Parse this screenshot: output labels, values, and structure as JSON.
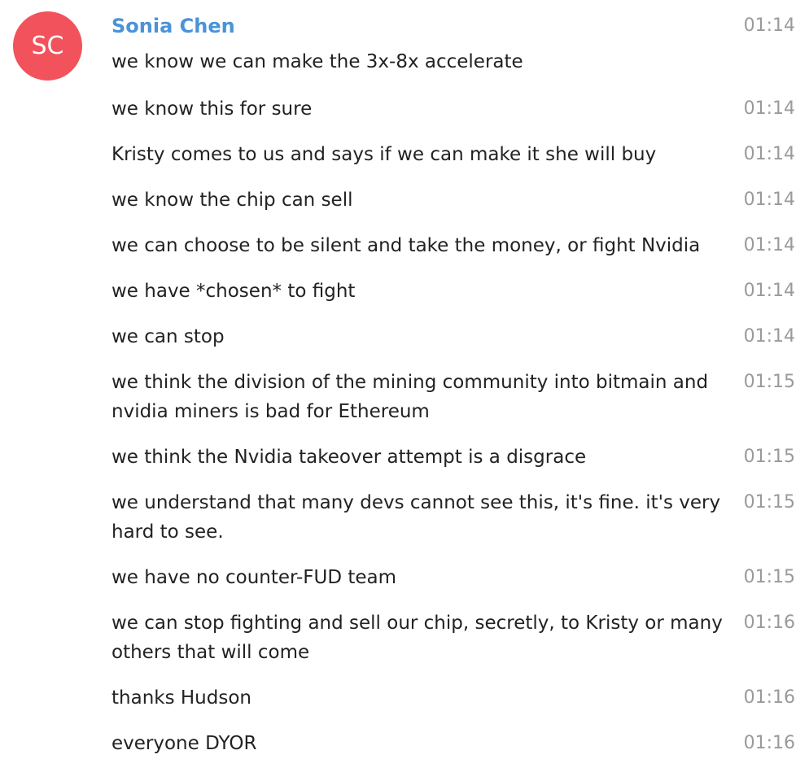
{
  "sender": {
    "initials": "SC",
    "name": "Sonia Chen",
    "avatar_color": "#f2525b",
    "name_color": "#4a93d8",
    "time": "01:14"
  },
  "messages": [
    {
      "text": "we know we can make the 3x-8x accelerate",
      "time": ""
    },
    {
      "text": "we know this for sure",
      "time": "01:14"
    },
    {
      "text": "Kristy comes to us and says if we can make it she will buy",
      "time": "01:14"
    },
    {
      "text": "we know the chip can sell",
      "time": "01:14"
    },
    {
      "text": "we can choose to be silent and take the money, or fight Nvidia",
      "time": "01:14"
    },
    {
      "text": "we have *chosen* to fight",
      "time": "01:14"
    },
    {
      "text": "we can stop",
      "time": "01:14"
    },
    {
      "text": "we think the division of the mining community into bitmain and nvidia miners is bad for Ethereum",
      "time": "01:15"
    },
    {
      "text": "we think the Nvidia takeover attempt is a disgrace",
      "time": "01:15"
    },
    {
      "text": "we understand that many devs cannot see this, it's fine. it's very hard to see.",
      "time": "01:15"
    },
    {
      "text": "we have no counter-FUD team",
      "time": "01:15"
    },
    {
      "text": "we can stop fighting and sell our chip, secretly, to Kristy or many others that will come",
      "time": "01:16"
    },
    {
      "text": "thanks Hudson",
      "time": "01:16"
    },
    {
      "text": "everyone DYOR",
      "time": "01:16"
    }
  ]
}
